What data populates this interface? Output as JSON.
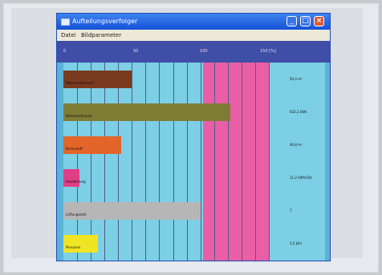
{
  "window": {
    "title": "Aufteilungsverfolger",
    "menu": [
      "Datei",
      "Bildparameter"
    ]
  },
  "axis_ticks": [
    "0",
    "50",
    "100",
    "150 [%]"
  ],
  "chart_data": {
    "type": "bar",
    "orientation": "horizontal",
    "xlim": [
      0,
      150
    ],
    "grid": true,
    "highlight_range": [
      100,
      150
    ],
    "rows": [
      {
        "name": "Wasserverbrauch",
        "value": 50,
        "color": "#7a3a1e",
        "display": "50,4 m³"
      },
      {
        "name": "Stromverbrauch",
        "value": 122,
        "color": "#7f7c36",
        "display": "632,2 kWh"
      },
      {
        "name": "Brennstoff",
        "value": 42,
        "color": "#e3652a",
        "display": "46,8 m³"
      },
      {
        "name": "Heizleistung",
        "value": 12,
        "color": "#df3f86",
        "display": "11,2 kWh/10a"
      },
      {
        "name": "Lüftungszahl",
        "value": 100,
        "color": "#b6b6b6",
        "display": "7"
      },
      {
        "name": "Personen",
        "value": 25,
        "color": "#f0e523",
        "display": "3,5 Jahr"
      }
    ]
  }
}
